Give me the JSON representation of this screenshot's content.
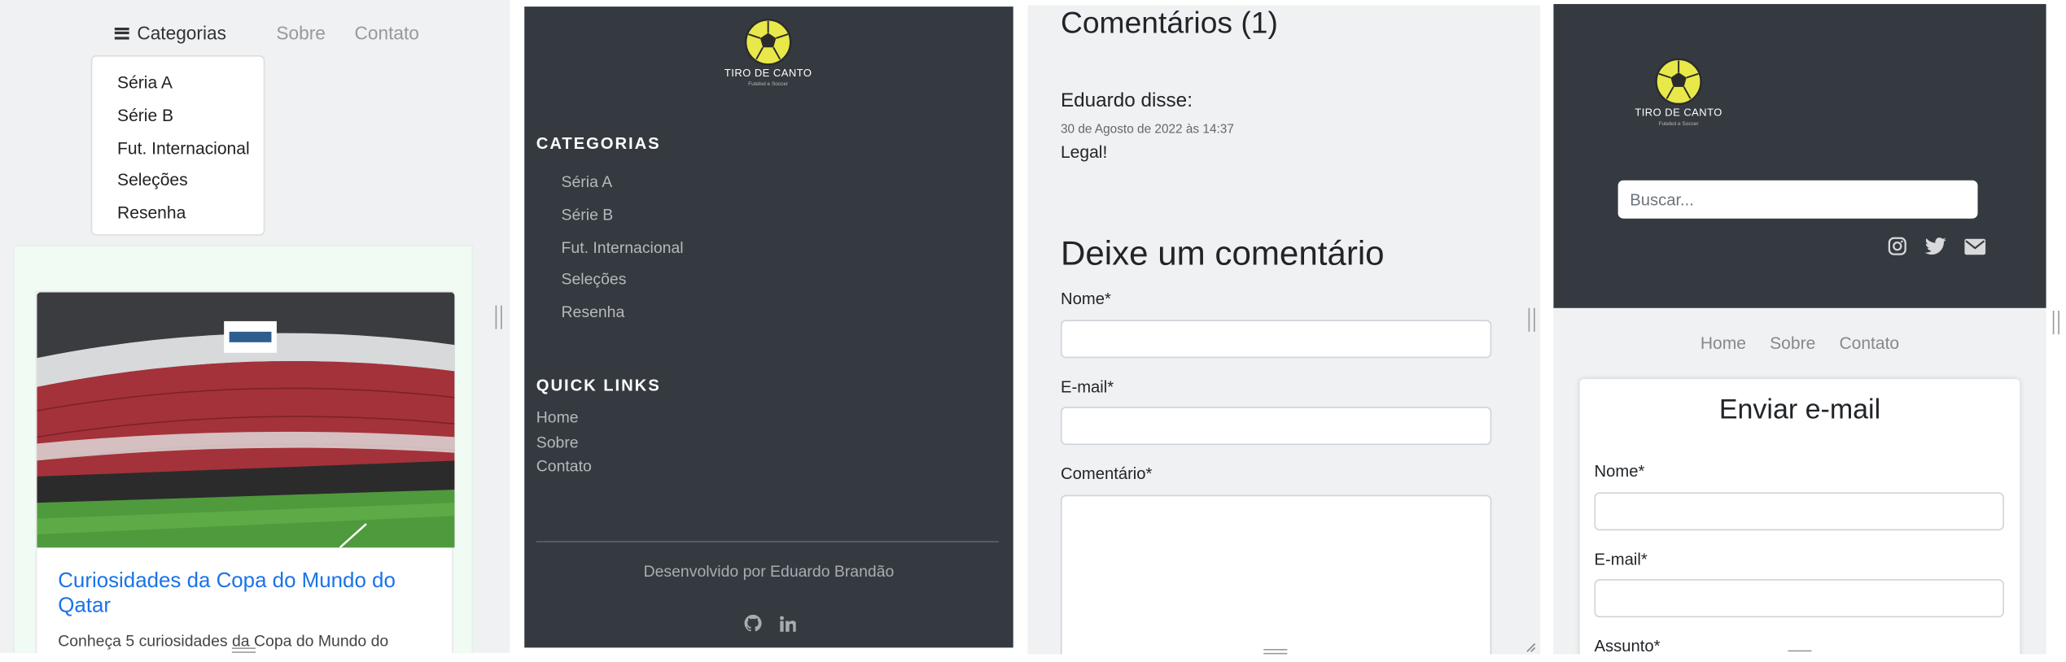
{
  "panel1": {
    "menu_label": "Categorias",
    "nav_links": [
      "Sobre",
      "Contato"
    ],
    "dropdown_items": [
      "Séria A",
      "Série B",
      "Fut. Internacional",
      "Seleções",
      "Resenha"
    ],
    "post": {
      "title": "Curiosidades da Copa do Mundo do Qatar",
      "excerpt": "Conheça 5 curiosidades da Copa do Mundo do"
    }
  },
  "panel2": {
    "brand": "TIRO DE CANTO",
    "brand_sub": "Futebol e Soccer",
    "categories_title": "CATEGORIAS",
    "categories": [
      "Séria A",
      "Série B",
      "Fut. Internacional",
      "Seleções",
      "Resenha"
    ],
    "quick_links_title": "QUICK LINKS",
    "quick_links": [
      "Home",
      "Sobre",
      "Contato"
    ],
    "credit": "Desenvolvido por Eduardo Brandão",
    "social_icons": [
      "github-icon",
      "linkedin-icon"
    ]
  },
  "panel3": {
    "comments_title": "Comentários (1)",
    "comment": {
      "author": "Eduardo disse:",
      "date": "30 de Agosto de 2022 às 14:37",
      "text": "Legal!"
    },
    "form_title": "Deixe um comentário",
    "fields": {
      "name_label": "Nome*",
      "email_label": "E-mail*",
      "comment_label": "Comentário*"
    }
  },
  "panel4": {
    "brand": "TIRO DE CANTO",
    "brand_sub": "Futebol e Soccer",
    "search_placeholder": "Buscar...",
    "social_icons": [
      "instagram-icon",
      "twitter-icon",
      "envelope-icon"
    ],
    "nav_links": [
      "Home",
      "Sobre",
      "Contato"
    ],
    "form_title": "Enviar e-mail",
    "fields": {
      "name_label": "Nome*",
      "email_label": "E-mail*",
      "subject_label": "Assunto*"
    }
  },
  "colors": {
    "dark_bg": "#343a40",
    "light_bg": "#f0f1f2",
    "link_blue": "#1a73e8",
    "logo_yellow": "#e8e84a"
  }
}
